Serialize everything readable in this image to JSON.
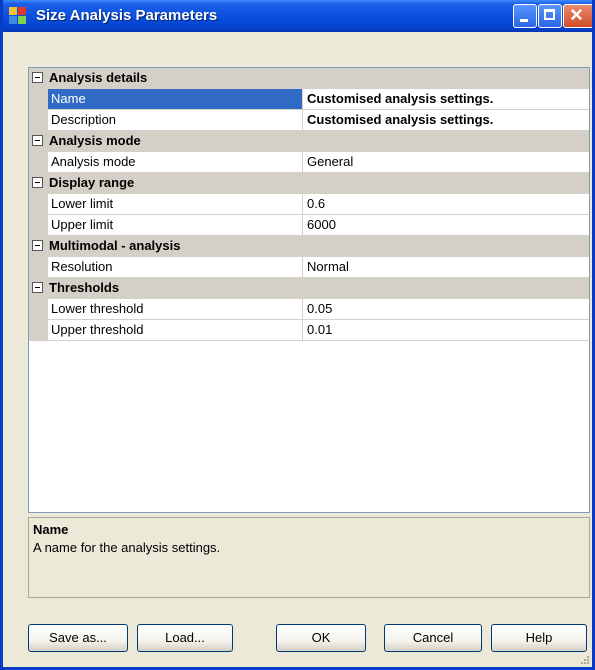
{
  "window": {
    "title": "Size Analysis Parameters",
    "controls": [
      "minimize",
      "maximize",
      "close"
    ]
  },
  "grid": {
    "categories": [
      {
        "label": "Analysis details",
        "properties": [
          {
            "name": "Name",
            "value": "Customised analysis settings.",
            "selected": true,
            "bold": true
          },
          {
            "name": "Description",
            "value": "Customised analysis settings.",
            "bold": true
          }
        ]
      },
      {
        "label": "Analysis mode",
        "properties": [
          {
            "name": "Analysis mode",
            "value": "General"
          }
        ]
      },
      {
        "label": "Display range",
        "properties": [
          {
            "name": "Lower limit",
            "value": "0.6"
          },
          {
            "name": "Upper limit",
            "value": "6000"
          }
        ]
      },
      {
        "label": "Multimodal - analysis",
        "properties": [
          {
            "name": "Resolution",
            "value": "Normal"
          }
        ]
      },
      {
        "label": "Thresholds",
        "properties": [
          {
            "name": "Lower threshold",
            "value": "0.05"
          },
          {
            "name": "Upper threshold",
            "value": "0.01"
          }
        ]
      }
    ]
  },
  "description": {
    "title": "Name",
    "text": "A name for the analysis settings."
  },
  "buttons": {
    "save_as": "Save as...",
    "load": "Load...",
    "ok": "OK",
    "cancel": "Cancel",
    "help": "Help"
  },
  "colors": {
    "title_bar": "#0a50e0",
    "selection": "#316ac5",
    "window_bg": "#ece9d8",
    "category_bg": "#d4d0c8"
  }
}
